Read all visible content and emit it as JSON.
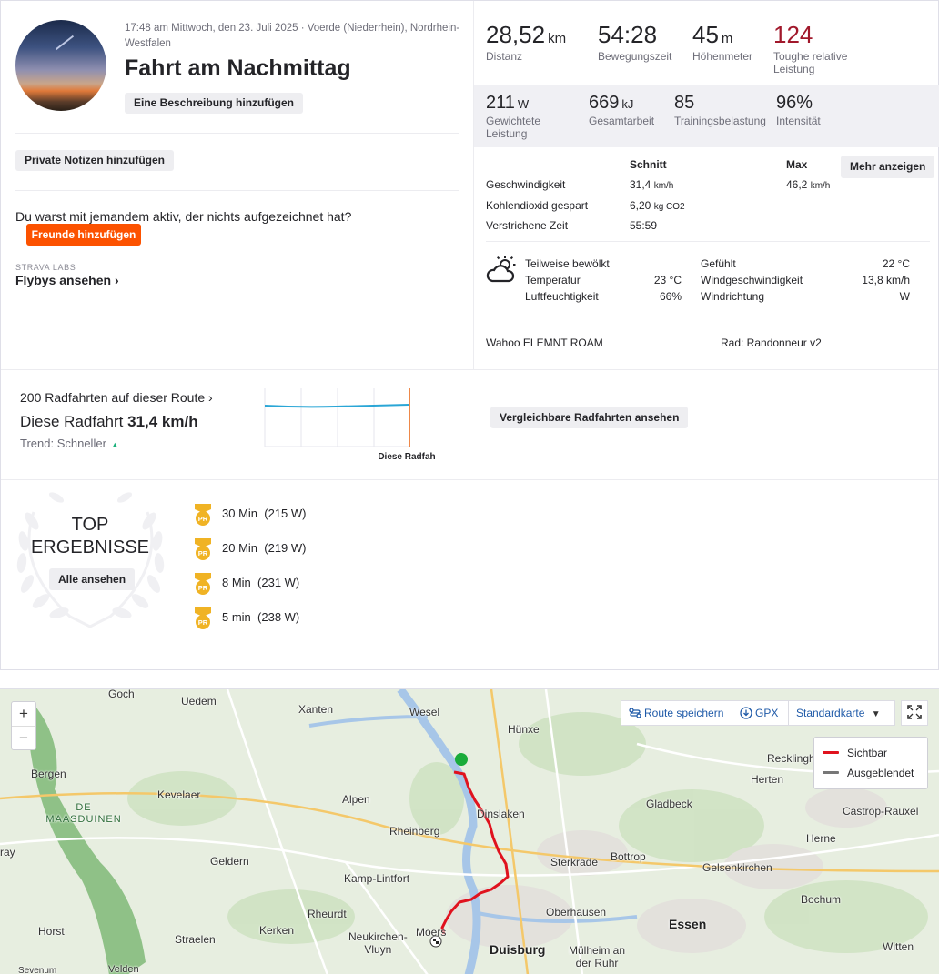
{
  "activity": {
    "meta": "17:48 am Mittwoch, den 23. Juli 2025 · Voerde (Niederrhein), Nordrhein-Westfalen",
    "title": "Fahrt am Nachmittag",
    "add_description": "Eine Beschreibung hinzufügen",
    "add_private_notes": "Private Notizen hinzufügen",
    "with_someone_question": "Du warst mit jemandem aktiv, der nichts aufgezeichnet hat?",
    "add_friends": "Freunde hinzufügen",
    "strava_labs": "STRAVA LABS",
    "flybys": "Flybys ansehen"
  },
  "stats_primary": [
    {
      "value": "28,52",
      "unit": "km",
      "label": "Distanz"
    },
    {
      "value": "54:28",
      "unit": "",
      "label": "Bewegungszeit"
    },
    {
      "value": "45",
      "unit": "m",
      "label": "Höhenmeter"
    },
    {
      "value": "124",
      "unit": "",
      "label": "Toughe relative Leistung"
    }
  ],
  "stats_secondary": [
    {
      "value": "211",
      "unit": "W",
      "label": "Gewichtete Leistung"
    },
    {
      "value": "669",
      "unit": "kJ",
      "label": "Gesamtarbeit"
    },
    {
      "value": "85",
      "unit": "",
      "label": "Trainingsbelastung"
    },
    {
      "value": "96%",
      "unit": "",
      "label": "Intensität"
    }
  ],
  "details": {
    "header_avg": "Schnitt",
    "header_max": "Max",
    "more_button": "Mehr anzeigen",
    "rows": [
      {
        "label": "Geschwindigkeit",
        "avg": "31,4",
        "avg_unit": "km/h",
        "max": "46,2",
        "max_unit": "km/h"
      },
      {
        "label": "Kohlendioxid gespart",
        "avg": "6,20",
        "avg_unit": "kg CO2",
        "max": "",
        "max_unit": ""
      },
      {
        "label": "Verstrichene Zeit",
        "avg": "55:59",
        "avg_unit": "",
        "max": "",
        "max_unit": ""
      }
    ]
  },
  "weather": {
    "icon": "partly-cloudy-icon",
    "condition": "Teilweise bewölkt",
    "temp_label": "Temperatur",
    "temp_value": "23",
    "temp_unit": "°C",
    "humidity_label": "Luftfeuchtigkeit",
    "humidity_value": "66%",
    "feels_label": "Gefühlt",
    "feels_value": "22",
    "feels_unit": "°C",
    "wind_speed_label": "Windgeschwindigkeit",
    "wind_speed_value": "13,8 km/h",
    "wind_dir_label": "Windrichtung",
    "wind_dir_value": "W"
  },
  "device": {
    "device_name": "Wahoo ELEMNT ROAM",
    "bike": "Rad: Randonneur v2"
  },
  "route_compare": {
    "count_link": "200 Radfahrten auf dieser Route",
    "main_prefix": "Diese Radfahrt",
    "main_value": "31,4 km/h",
    "trend": "Trend: Schneller",
    "chart_label": "Diese Radfah",
    "compare_button": "Vergleichbare Radfahrten ansehen"
  },
  "top_results": {
    "title_line1": "TOP",
    "title_line2": "ERGEBNISSE",
    "see_all": "Alle ansehen",
    "badge_text": "PR",
    "items": [
      {
        "duration": "30 Min",
        "power": "(215 W)"
      },
      {
        "duration": "20 Min",
        "power": "(219 W)"
      },
      {
        "duration": "8 Min",
        "power": "(231 W)"
      },
      {
        "duration": "5 min",
        "power": "(238 W)"
      }
    ]
  },
  "map": {
    "zoom_in": "+",
    "zoom_out": "−",
    "save_route": "Route speichern",
    "gpx": "GPX",
    "map_type": "Standardkarte",
    "legend_visible": "Sichtbar",
    "legend_hidden": "Ausgeblendet",
    "route_color": "#e0121e",
    "start_color": "#1aab3a",
    "places": [
      "Goch",
      "Uedem",
      "Xanten",
      "Wesel",
      "Hünxe",
      "Bergen",
      "DE",
      "MAASDUINEN",
      "Kevelaer",
      "Alpen",
      "Dinslaken",
      "Gladbeck",
      "Recklingh",
      "Herten",
      "Castrop-Rauxel",
      "ray",
      "Rheinberg",
      "Geldern",
      "Kamp-Lintfort",
      "Sterkrade",
      "Bottrop",
      "Gelsenkirchen",
      "Herne",
      "Rheurdt",
      "Oberhausen",
      "Essen",
      "Bochum",
      "Horst",
      "Straelen",
      "Kerken",
      "Neukirchen-",
      "Vluyn",
      "Moers",
      "Duisburg",
      "Mülheim an",
      "der Ruhr",
      "Witten",
      "Sevenum",
      "Velden"
    ]
  },
  "colors": {
    "brand_orange": "#fc5200",
    "relative_effort_red": "#a1182b",
    "pr_gold": "#f0b324",
    "trend_green": "#1bb17c",
    "chart_line": "#2aa6d6"
  }
}
